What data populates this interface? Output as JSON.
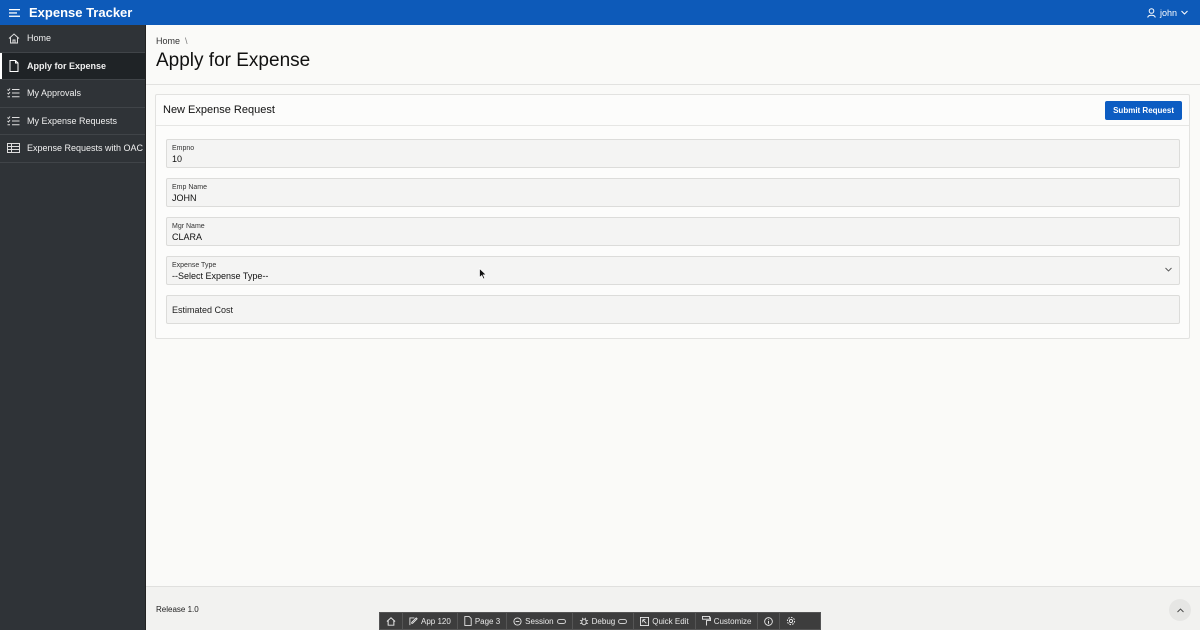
{
  "header": {
    "app_title": "Expense Tracker",
    "user": "john",
    "brand_color": "#0d5ab9"
  },
  "sidebar": {
    "items": [
      {
        "label": "Home",
        "icon": "home-icon",
        "active": false
      },
      {
        "label": "Apply for Expense",
        "icon": "document-icon",
        "active": true
      },
      {
        "label": "My Approvals",
        "icon": "checklist-icon",
        "active": false
      },
      {
        "label": "My Expense Requests",
        "icon": "checklist-icon",
        "active": false
      },
      {
        "label": "Expense Requests with OAC",
        "icon": "table-icon",
        "active": false
      }
    ]
  },
  "breadcrumb": {
    "home": "Home",
    "separator": "\\"
  },
  "page": {
    "title": "Apply for Expense"
  },
  "region": {
    "title": "New Expense Request",
    "submit_label": "Submit Request"
  },
  "form": {
    "empno": {
      "label": "Empno",
      "value": "10"
    },
    "emp_name": {
      "label": "Emp Name",
      "value": "JOHN"
    },
    "mgr_name": {
      "label": "Mgr Name",
      "value": "CLARA"
    },
    "expense_type": {
      "label": "Expense Type",
      "value": "--Select Expense Type--"
    },
    "estimated_cost": {
      "label": "Estimated Cost",
      "value": ""
    }
  },
  "footer": {
    "release": "Release 1.0"
  },
  "devbar": {
    "app": "App 120",
    "page": "Page 3",
    "session": "Session",
    "debug": "Debug",
    "quick_edit": "Quick Edit",
    "customize": "Customize"
  }
}
